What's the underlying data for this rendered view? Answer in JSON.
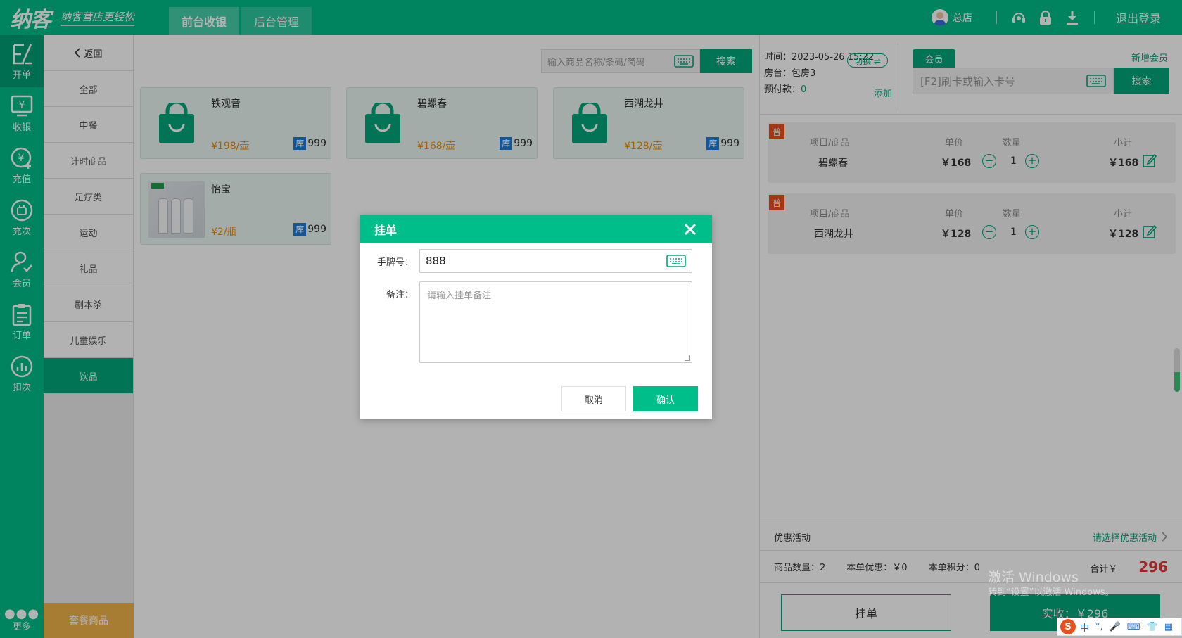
{
  "topbar": {
    "logo": "纳客",
    "slogan": "纳客营店更轻松",
    "tabs": [
      {
        "label": "前台收银"
      },
      {
        "label": "后台管理"
      }
    ],
    "store": "总店",
    "logout": "退出登录"
  },
  "leftnav": {
    "items": [
      {
        "label": "开单",
        "icon": "order-open-icon"
      },
      {
        "label": "收银",
        "icon": "cashier-icon"
      },
      {
        "label": "充值",
        "icon": "recharge-icon"
      },
      {
        "label": "充次",
        "icon": "recharge-count-icon"
      },
      {
        "label": "会员",
        "icon": "member-icon"
      },
      {
        "label": "订单",
        "icon": "orders-icon"
      },
      {
        "label": "扣次",
        "icon": "deduct-icon"
      }
    ],
    "more": "更多"
  },
  "categories": {
    "back": "返回",
    "items": [
      "全部",
      "中餐",
      "计时商品",
      "足疗类",
      "运动",
      "礼品",
      "剧本杀",
      "儿童娱乐",
      "饮品"
    ],
    "active_index": 8,
    "bottom": "套餐商品"
  },
  "search": {
    "placeholder": "输入商品名称/条码/简码",
    "button": "搜索"
  },
  "products": [
    {
      "name": "铁观音",
      "price": "¥198/壶",
      "stock_label": "库",
      "stock": "999"
    },
    {
      "name": "碧螺春",
      "price": "¥168/壶",
      "stock_label": "库",
      "stock": "999"
    },
    {
      "name": "西湖龙井",
      "price": "¥128/壶",
      "stock_label": "库",
      "stock": "999"
    },
    {
      "name": "怡宝",
      "price": "¥2/瓶",
      "stock_label": "库",
      "stock": "999"
    }
  ],
  "order": {
    "time_label": "时间：",
    "time": "2023-05-26 15:22",
    "room_label": "房台：",
    "room": "包房3",
    "switch": "切换 ⇌",
    "prepay_label": "预付款：",
    "prepay": "0",
    "add": "添加",
    "member_tab": "会员",
    "new_member": "新增会员",
    "card_placeholder": "[F2]刷卡或输入卡号",
    "card_search": "搜索",
    "headers": {
      "item": "项目/商品",
      "unit_price": "单价",
      "qty": "数量",
      "subtotal": "小计"
    },
    "items": [
      {
        "tag": "普",
        "name": "碧螺春",
        "unit_price": "￥168",
        "qty": "1",
        "subtotal": "￥168"
      },
      {
        "tag": "普",
        "name": "西湖龙井",
        "unit_price": "￥128",
        "qty": "1",
        "subtotal": "￥128"
      }
    ],
    "promo_label": "优惠活动",
    "promo_select": "请选择优惠活动",
    "qty_summary": "商品数量：2",
    "discount_summary": "本单优惠：￥0",
    "points_summary": "本单积分：0",
    "total_label": "合计￥",
    "total": "296",
    "hang_button": "挂单",
    "pay_button": "实收：￥296"
  },
  "modal": {
    "title": "挂单",
    "tag_label": "手牌号：",
    "tag_value": "888",
    "note_label": "备注：",
    "note_placeholder": "请输入挂单备注",
    "cancel": "取消",
    "confirm": "确认"
  },
  "watermark": {
    "line1": "激活 Windows",
    "line2": "转到“设置”以激活 Windows。"
  },
  "ime": {
    "label": "中"
  },
  "colors": {
    "primary": "#00be8a",
    "primary_dark": "#00a67a",
    "accent_orange": "#f08c00",
    "danger": "#e53935"
  }
}
